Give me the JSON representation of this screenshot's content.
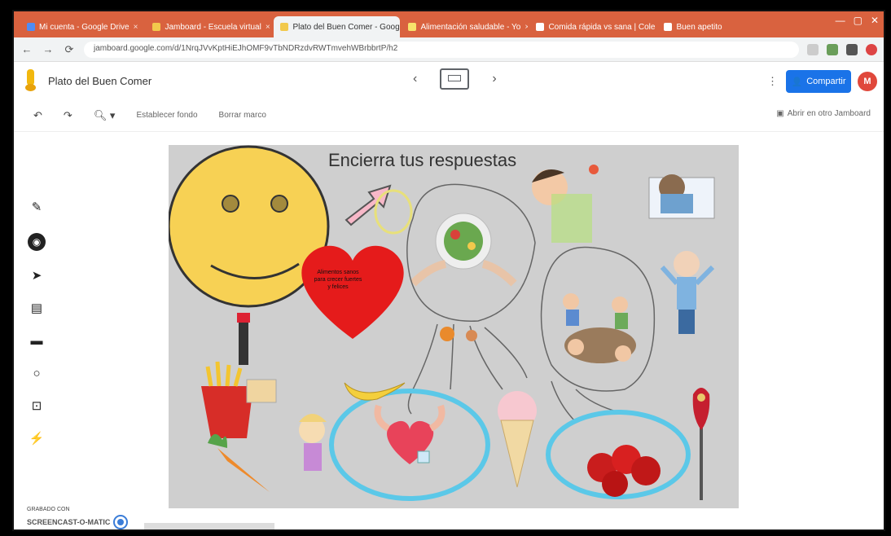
{
  "browser": {
    "tabs": [
      {
        "label": "Mi cuenta - Google Drive",
        "active": false
      },
      {
        "label": "Jamboard - Escuela virtual",
        "active": false
      },
      {
        "label": "Plato del Buen Comer - Googl",
        "active": true
      },
      {
        "label": "Alimentación saludable - Yo",
        "active": false
      },
      {
        "label": "Comida rápida vs sana | Colec",
        "active": false
      },
      {
        "label": "Buen apetito",
        "active": false
      }
    ],
    "url": "jamboard.google.com/d/1NrqJVvKptHiEJhOMF9vTbNDRzdvRWTmvehWBrbbrtP/h2"
  },
  "app": {
    "title": "Plato del Buen Comer",
    "share_label": "Compartir",
    "avatar_letter": "M",
    "more_label": "⋮"
  },
  "toolbar": {
    "undo_icon": "undo-icon",
    "redo_icon": "redo-icon",
    "zoom_icon": "zoom-icon",
    "clear_label": "Establecer fondo",
    "clear_frame_label": "Borrar marco",
    "frame_bg_label": "Abrir en otro Jamboard"
  },
  "tools": [
    "pen-icon",
    "eraser-icon",
    "select-icon",
    "sticky-note-icon",
    "image-icon",
    "circle-icon",
    "text-box-icon",
    "laser-icon"
  ],
  "canvas": {
    "title": "Encierra tus respuestas",
    "heart_note": "Alimentos sanos para crecer fuertes y felices"
  },
  "recorder": {
    "caption": "GRABADO CON",
    "brand": "SCREENCAST-O-MATIC"
  },
  "colors": {
    "tabstrip": "#d9623f",
    "canvas": "#cfcfcf",
    "share": "#1a73e8",
    "cyan_circle": "#5bc8e8",
    "pen_gray": "#555555"
  }
}
